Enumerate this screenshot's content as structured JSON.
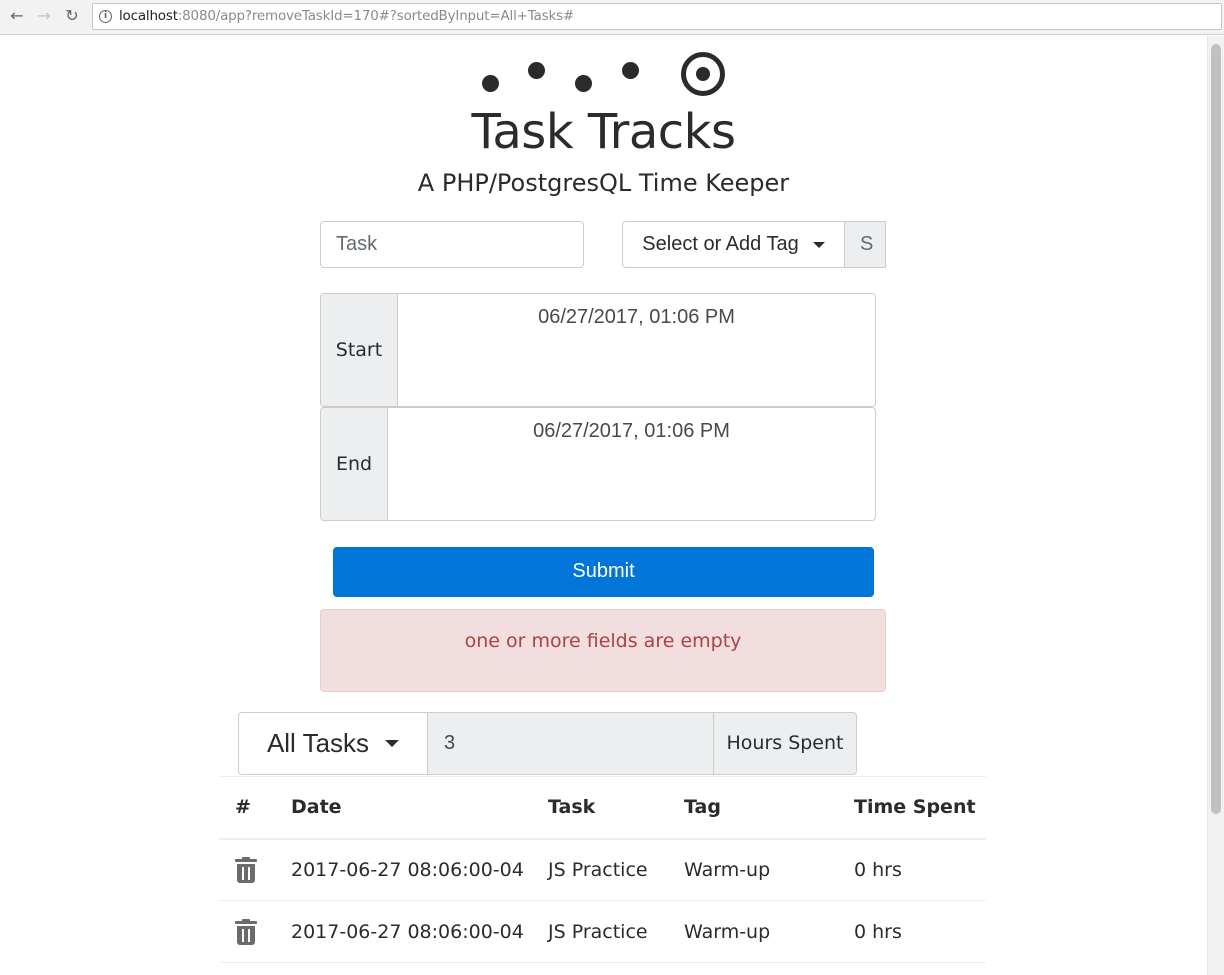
{
  "browser": {
    "url_host": "localhost",
    "url_rest": ":8080/app?removeTaskId=170#?sortedByInput=All+Tasks#",
    "back_icon": "arrow-left-icon",
    "forward_icon": "arrow-right-icon",
    "reload_icon": "reload-icon"
  },
  "header": {
    "title": "Task Tracks",
    "subtitle": "A PHP/PostgresQL Time Keeper"
  },
  "form": {
    "task_placeholder": "Task",
    "tag_select_label": "Select or Add Tag",
    "tag_addon_text": "S",
    "start_label": "Start",
    "start_value": "06/27/2017, 01:06 PM",
    "end_label": "End",
    "end_value": "06/27/2017, 01:06 PM",
    "submit_label": "Submit"
  },
  "alert": {
    "message": "one or more fields are empty"
  },
  "filter": {
    "selected": "All Tasks",
    "hours_value": "3",
    "hours_label": "Hours Spent"
  },
  "table": {
    "headers": [
      "#",
      "Date",
      "Task",
      "Tag",
      "Time Spent"
    ],
    "rows": [
      {
        "date": "2017-06-27 08:06:00-04",
        "task": "JS Practice",
        "tag": "Warm-up",
        "time": "0 hrs"
      },
      {
        "date": "2017-06-27 08:06:00-04",
        "task": "JS Practice",
        "tag": "Warm-up",
        "time": "0 hrs"
      }
    ]
  },
  "colors": {
    "primary": "#0275d8",
    "alert_bg": "#f2dede",
    "alert_text": "#a94442",
    "addon_bg": "#eceeef"
  }
}
